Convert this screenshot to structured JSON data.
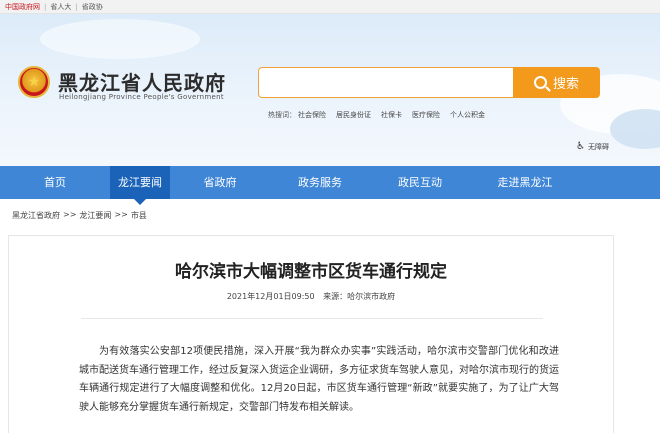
{
  "topbar": {
    "links": [
      "中国政府网",
      "省人大",
      "省政协"
    ]
  },
  "header": {
    "site_title": "黑龙江省人民政府",
    "site_subtitle": "Heilongjiang Province People's Government",
    "search": {
      "placeholder": "",
      "button_label": "搜索"
    },
    "hot_label": "热搜词：",
    "hot_keywords": [
      "社会保险",
      "居民身份证",
      "社保卡",
      "医疗保险",
      "个人公积金"
    ],
    "accessibility_label": "无障碍"
  },
  "nav": {
    "items": [
      "首页",
      "龙江要闻",
      "省政府",
      "政务服务",
      "政民互动",
      "走进黑龙江"
    ],
    "active_index": 1
  },
  "breadcrumb": {
    "items": [
      "黑龙江省政府",
      "龙江要闻",
      "市县"
    ],
    "separator": ">>"
  },
  "article": {
    "title": "哈尔滨市大幅调整市区货车通行规定",
    "date": "2021年12月01日09:50",
    "source": "来源：哈尔滨市政府",
    "body": "为有效落实公安部12项便民措施，深入开展“我为群众办实事”实践活动，哈尔滨市交警部门优化和改进城市配送货车通行管理工作，经过反复深入货运企业调研，多方征求货车驾驶人意见，对哈尔滨市现行的货运车辆通行规定进行了大幅度调整和优化。12月20日起，市区货车通行管理“新政”就要实施了，为了让广大驾驶人能够充分掌握货车通行新规定，交警部门特发布相关解读。"
  },
  "colors": {
    "nav_bg": "#3f86d6",
    "nav_active": "#1b63b8",
    "search_button": "#f39a1d",
    "brand_red": "#c8161e"
  }
}
